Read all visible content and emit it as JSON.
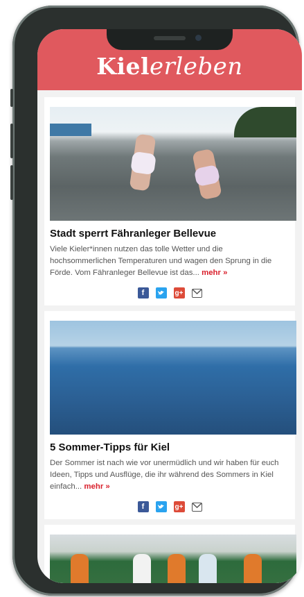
{
  "header": {
    "logo_main": "Kiel",
    "logo_script": "erleben",
    "color": "#e0595e"
  },
  "articles": [
    {
      "title": "Stadt sperrt Fähranleger Bellevue",
      "teaser": "Viele Kieler*innen nutzen das tolle Wetter und die hochsommerlichen Temperaturen und wagen den Sprung in die Förde. Vom Fähranleger Bellevue ist das...",
      "more": "mehr »"
    },
    {
      "title": "5 Sommer-Tipps für Kiel",
      "teaser": "Der Sommer ist nach wie vor unermüdlich und wir haben für euch Ideen, Tipps und Ausflüge, die ihr während des Sommers in Kiel einfach...",
      "more": "mehr »"
    }
  ],
  "share": {
    "facebook": "f",
    "twitter": "t",
    "googleplus": "g+",
    "email_icon": "email-icon"
  }
}
